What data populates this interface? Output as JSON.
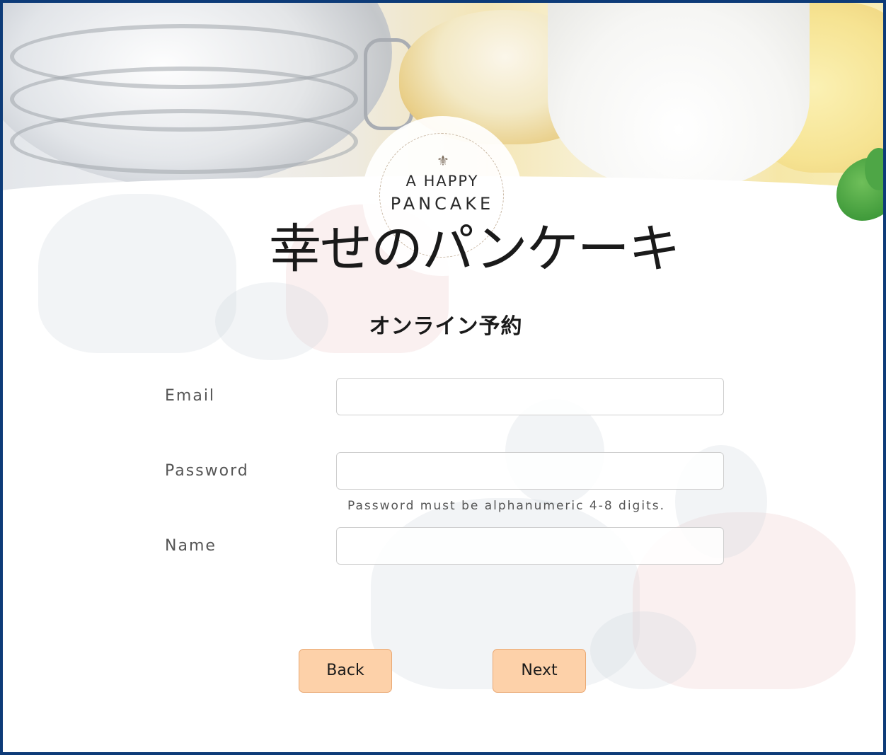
{
  "logo": {
    "line1": "A HAPPY",
    "line2": "PANCAKE",
    "brand_jp": "幸せのパンケーキ",
    "icon": "fleur-de-lis-icon"
  },
  "page": {
    "subtitle": "オンライン予約"
  },
  "form": {
    "email": {
      "label": "Email",
      "value": "",
      "placeholder": ""
    },
    "password": {
      "label": "Password",
      "value": "",
      "placeholder": "",
      "hint": "Password must be alphanumeric 4-8 digits."
    },
    "name": {
      "label": "Name",
      "value": "",
      "placeholder": ""
    }
  },
  "actions": {
    "back_label": "Back",
    "next_label": "Next"
  },
  "colors": {
    "frame_border": "#0d3b78",
    "button_bg": "#fdd1a9",
    "button_border": "#e9a873"
  }
}
